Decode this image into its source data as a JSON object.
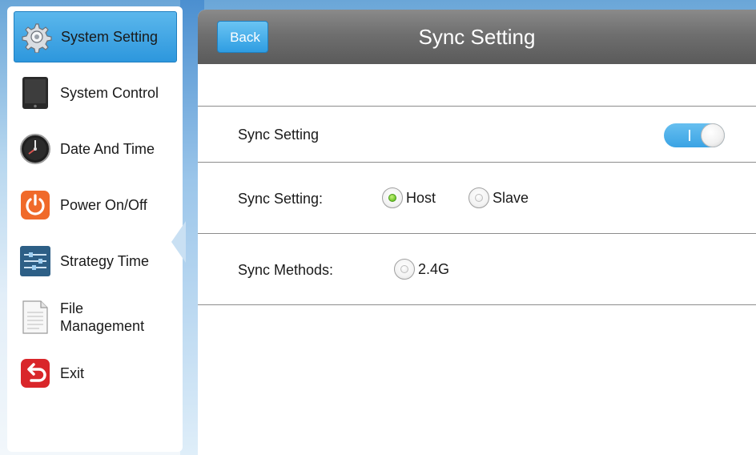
{
  "sidebar": {
    "items": [
      {
        "label": "System Setting",
        "icon": "gear-icon",
        "active": true
      },
      {
        "label": "System Control",
        "icon": "tablet-icon",
        "active": false
      },
      {
        "label": "Date And Time",
        "icon": "clock-icon",
        "active": false
      },
      {
        "label": "Power On/Off",
        "icon": "power-icon",
        "active": false
      },
      {
        "label": "Strategy Time",
        "icon": "sliders-icon",
        "active": false
      },
      {
        "label": "File Management",
        "icon": "document-icon",
        "active": false
      },
      {
        "label": "Exit",
        "icon": "exit-icon",
        "active": false
      }
    ]
  },
  "header": {
    "back_label": "Back",
    "title": "Sync Setting"
  },
  "settings": {
    "sync_toggle": {
      "label": "Sync Setting",
      "on": true
    },
    "sync_mode": {
      "label": "Sync Setting:",
      "options": [
        {
          "label": "Host",
          "selected": true
        },
        {
          "label": "Slave",
          "selected": false
        }
      ]
    },
    "sync_methods": {
      "label": "Sync Methods:",
      "options": [
        {
          "label": "2.4G",
          "selected": false
        }
      ]
    }
  },
  "colors": {
    "accent": "#2f9de2",
    "titlebar": "#6f6f6f",
    "radio_selected": "#6fc62a"
  }
}
